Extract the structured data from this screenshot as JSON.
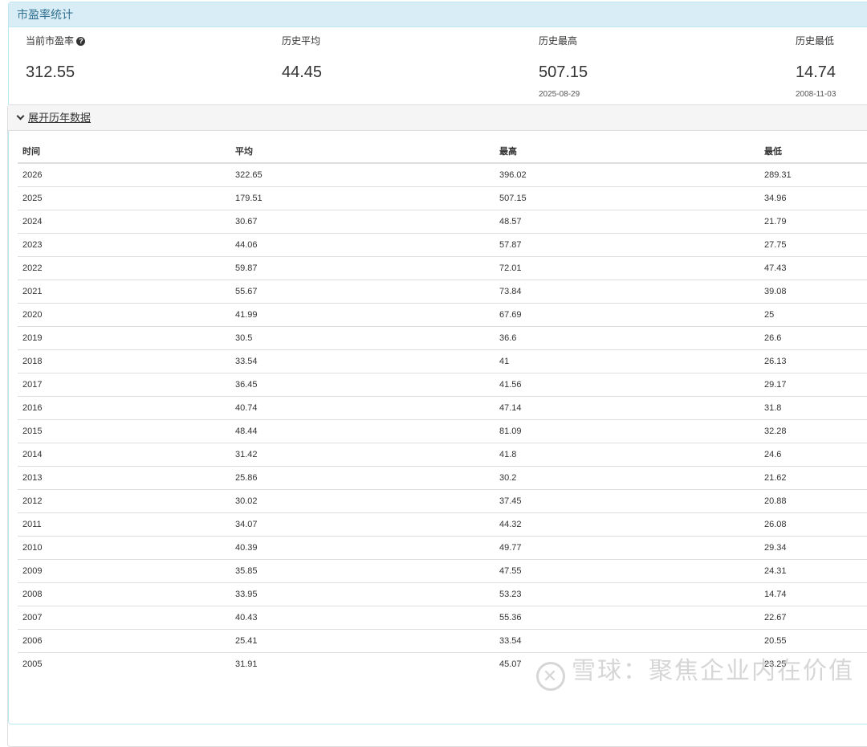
{
  "panel": {
    "title": "市盈率统计"
  },
  "stats": [
    {
      "label": "当前市盈率",
      "value": "312.55",
      "help": "?"
    },
    {
      "label": "历史平均",
      "value": "44.45"
    },
    {
      "label": "历史最高",
      "value": "507.15",
      "date": "2025-08-29"
    },
    {
      "label": "历史最低",
      "value": "14.74",
      "date": "2008-11-03"
    }
  ],
  "history": {
    "toggle_label": "展开历年数据",
    "columns": [
      "时间",
      "平均",
      "最高",
      "最低"
    ],
    "rows": [
      [
        "2026",
        "322.65",
        "396.02",
        "289.31"
      ],
      [
        "2025",
        "179.51",
        "507.15",
        "34.96"
      ],
      [
        "2024",
        "30.67",
        "48.57",
        "21.79"
      ],
      [
        "2023",
        "44.06",
        "57.87",
        "27.75"
      ],
      [
        "2022",
        "59.87",
        "72.01",
        "47.43"
      ],
      [
        "2021",
        "55.67",
        "73.84",
        "39.08"
      ],
      [
        "2020",
        "41.99",
        "67.69",
        "25"
      ],
      [
        "2019",
        "30.5",
        "36.6",
        "26.6"
      ],
      [
        "2018",
        "33.54",
        "41",
        "26.13"
      ],
      [
        "2017",
        "36.45",
        "41.56",
        "29.17"
      ],
      [
        "2016",
        "40.74",
        "47.14",
        "31.8"
      ],
      [
        "2015",
        "48.44",
        "81.09",
        "32.28"
      ],
      [
        "2014",
        "31.42",
        "41.8",
        "24.6"
      ],
      [
        "2013",
        "25.86",
        "30.2",
        "21.62"
      ],
      [
        "2012",
        "30.02",
        "37.45",
        "20.88"
      ],
      [
        "2011",
        "34.07",
        "44.32",
        "26.08"
      ],
      [
        "2010",
        "40.39",
        "49.77",
        "29.34"
      ],
      [
        "2009",
        "35.85",
        "47.55",
        "24.31"
      ],
      [
        "2008",
        "33.95",
        "53.23",
        "14.74"
      ],
      [
        "2007",
        "40.43",
        "55.36",
        "22.67"
      ],
      [
        "2006",
        "25.41",
        "33.54",
        "20.55"
      ],
      [
        "2005",
        "31.91",
        "45.07",
        "23.25"
      ]
    ]
  },
  "watermark": {
    "text": "雪球：聚焦企业内在价值"
  }
}
